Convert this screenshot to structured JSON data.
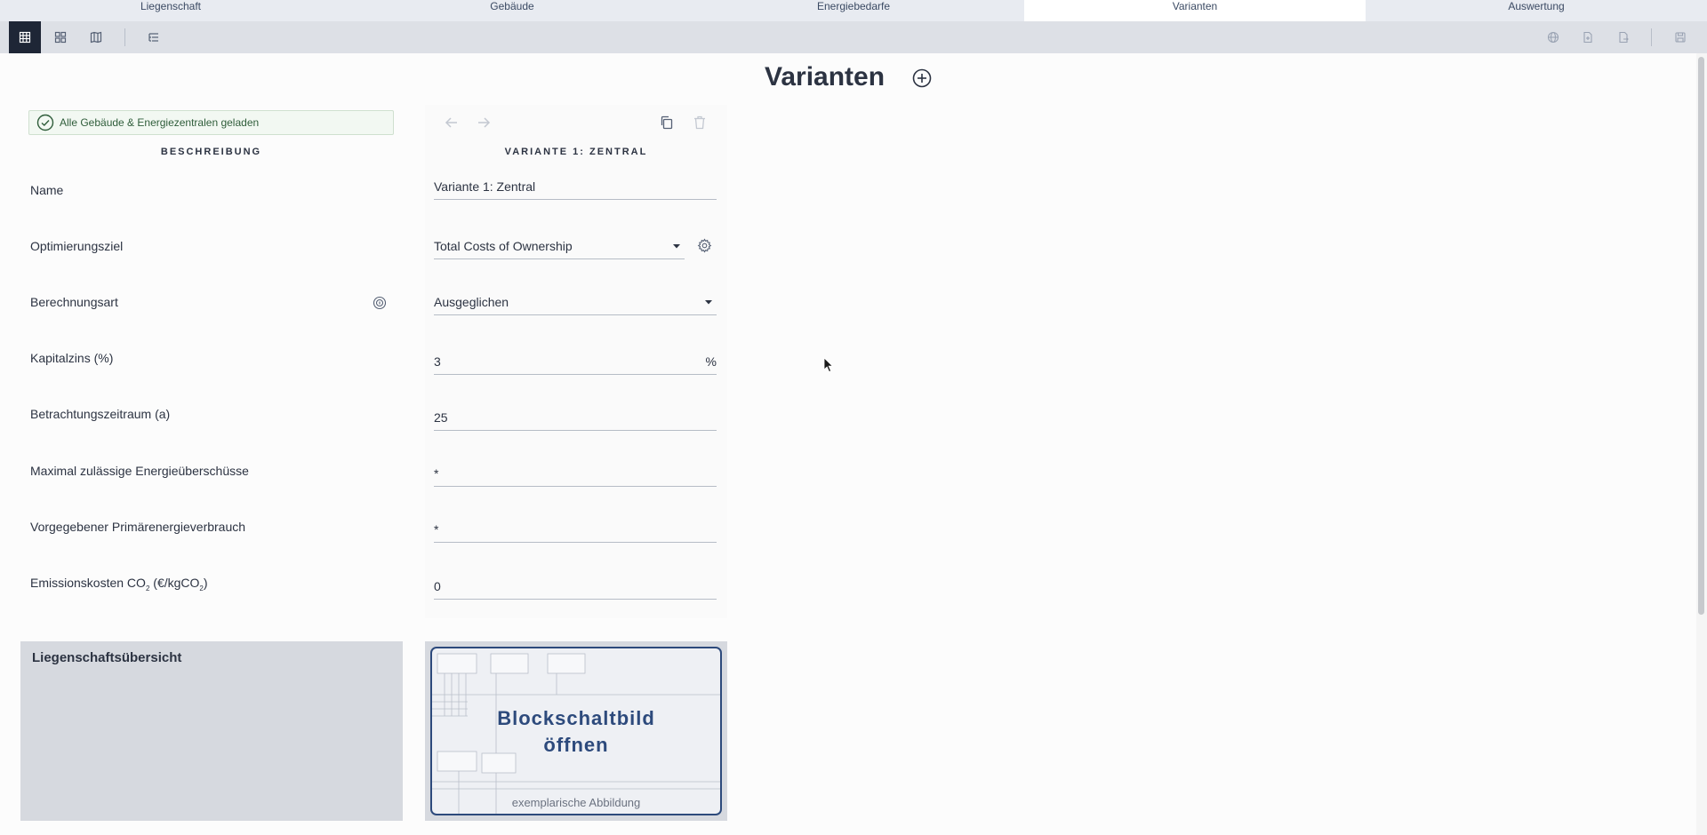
{
  "tabs": [
    {
      "label": "Liegenschaft",
      "active": false
    },
    {
      "label": "Gebäude",
      "active": false
    },
    {
      "label": "Energiebedarfe",
      "active": false
    },
    {
      "label": "Varianten",
      "active": true
    },
    {
      "label": "Auswertung",
      "active": false
    }
  ],
  "toolbar": {
    "left_icons": [
      "table-view-icon",
      "grid-view-icon",
      "map-view-icon",
      "list-settings-icon"
    ],
    "right_icons": [
      "globe-icon",
      "document-icon",
      "export-icon",
      "save-icon"
    ]
  },
  "page": {
    "title": "Varianten"
  },
  "status": {
    "text": "Alle Gebäude & Energiezentralen geladen"
  },
  "columns": {
    "description_header": "BESCHREIBUNG",
    "variant_header": "VARIANTE 1: ZENTRAL"
  },
  "rows": [
    {
      "label": "Name",
      "value": "Variante 1: Zentral"
    },
    {
      "label": "Optimierungsziel",
      "value": "Total Costs of Ownership"
    },
    {
      "label": "Berechnungsart",
      "value": "Ausgeglichen"
    },
    {
      "label": "Kapitalzins (%)",
      "value": "3",
      "suffix": "%"
    },
    {
      "label": "Betrachtungszeitraum (a)",
      "value": "25"
    },
    {
      "label": "Maximal zulässige Energieüberschüsse",
      "value": "*"
    },
    {
      "label": "Vorgegebener Primärenergieverbrauch",
      "value": "*"
    },
    {
      "label": "Emissionskosten CO",
      "value": "0"
    }
  ],
  "emission": {
    "base": "Emissionskosten CO",
    "sub1": "2",
    "mid": " (€/kgCO",
    "sub2": "2",
    "end": ")"
  },
  "cards": {
    "overview_title": "Liegenschaftsübersicht",
    "block_title_line1": "Blockschaltbild",
    "block_title_line2": "öffnen",
    "block_caption": "exemplarische Abbildung"
  },
  "colors": {
    "accent": "#2d4a7c",
    "status_green": "#2f5d3a",
    "toolbar_active": "#1e2636"
  }
}
